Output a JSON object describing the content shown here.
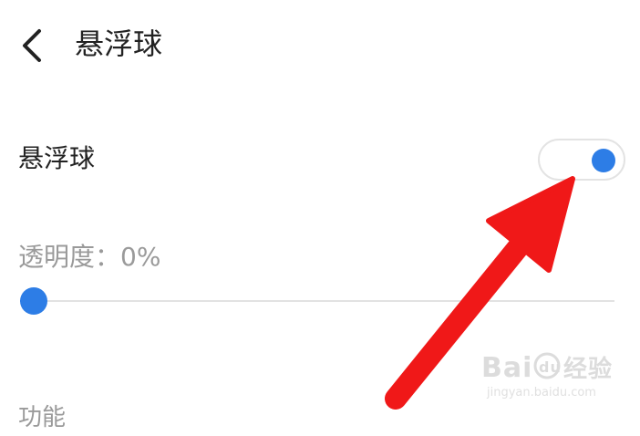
{
  "header": {
    "back_icon": "chevron-left-icon",
    "title": "悬浮球"
  },
  "floating_ball": {
    "label": "悬浮球",
    "enabled": true,
    "accent_color": "#2d7de6"
  },
  "opacity": {
    "label": "透明度：0%",
    "value_percent": 0
  },
  "section": {
    "label": "功能"
  },
  "annotation": {
    "arrow_color": "#f01818",
    "arrow_icon": "red-arrow-annotation"
  },
  "watermark": {
    "logo": "Baidu经验",
    "url": "jingyan.baidu.com"
  }
}
